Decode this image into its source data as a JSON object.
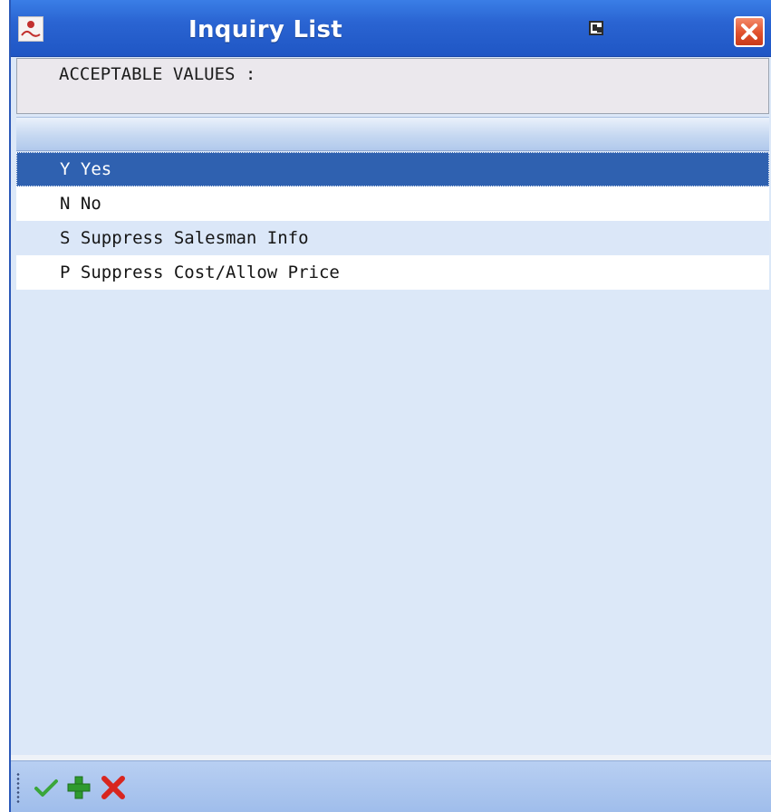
{
  "window": {
    "title": "Inquiry List"
  },
  "header": {
    "text": "ACCEPTABLE VALUES :"
  },
  "list": {
    "items": [
      {
        "code": "Y",
        "label": "Y Yes",
        "selected": true
      },
      {
        "code": "N",
        "label": "N No",
        "selected": false
      },
      {
        "code": "S",
        "label": "S Suppress Salesman Info",
        "selected": false
      },
      {
        "code": "P",
        "label": "P Suppress Cost/Allow Price",
        "selected": false
      }
    ]
  },
  "toolbar": {
    "buttons": [
      {
        "name": "accept",
        "icon": "check-icon"
      },
      {
        "name": "add",
        "icon": "plus-icon"
      },
      {
        "name": "cancel",
        "icon": "x-icon"
      }
    ]
  },
  "colors": {
    "titlebar": "#2a64d2",
    "selection": "#2f61b0",
    "list_background": "#dce8f8",
    "close_button": "#e0512d"
  }
}
